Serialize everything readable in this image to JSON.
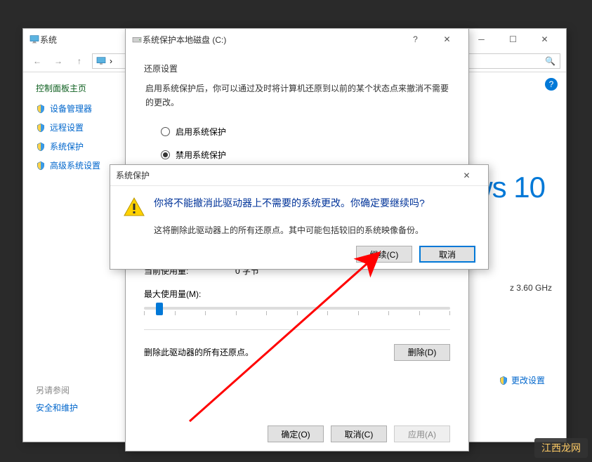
{
  "system_window": {
    "title": "系统",
    "sidebar_heading": "控制面板主页",
    "links": {
      "device_manager": "设备管理器",
      "remote_settings": "远程设置",
      "system_protection": "系统保护",
      "advanced_settings": "高级系统设置"
    },
    "search_placeholder": "搜",
    "help_tooltip": "?",
    "win10_text": "ws 10",
    "cpu_fragment": "z   3.60 GHz",
    "change_settings": "更改设置",
    "see_also_heading": "另请参阅",
    "see_also_link": "安全和维护"
  },
  "props_dialog": {
    "title": "系统保护本地磁盘 (C:)",
    "restore_heading": "还原设置",
    "restore_desc": "启用系统保护后，你可以通过及时将计算机还原到以前的某个状态点来撤消不需要的更改。",
    "radio_enable": "启用系统保护",
    "radio_disable": "禁用系统保护",
    "usage_label": "当前使用量:",
    "usage_value": "0 字节",
    "max_usage_label": "最大使用量(M):",
    "delete_desc": "删除此驱动器的所有还原点。",
    "delete_btn": "删除(D)",
    "ok_btn": "确定(O)",
    "cancel_btn": "取消(C)",
    "apply_btn": "应用(A)"
  },
  "confirm_dialog": {
    "title": "系统保护",
    "headline": "你将不能撤消此驱动器上不需要的系统更改。你确定要继续吗?",
    "subline": "这将删除此驱动器上的所有还原点。其中可能包括较旧的系统映像备份。",
    "continue_btn": "继续(C)",
    "cancel_btn": "取消"
  },
  "watermark": "江西龙网"
}
